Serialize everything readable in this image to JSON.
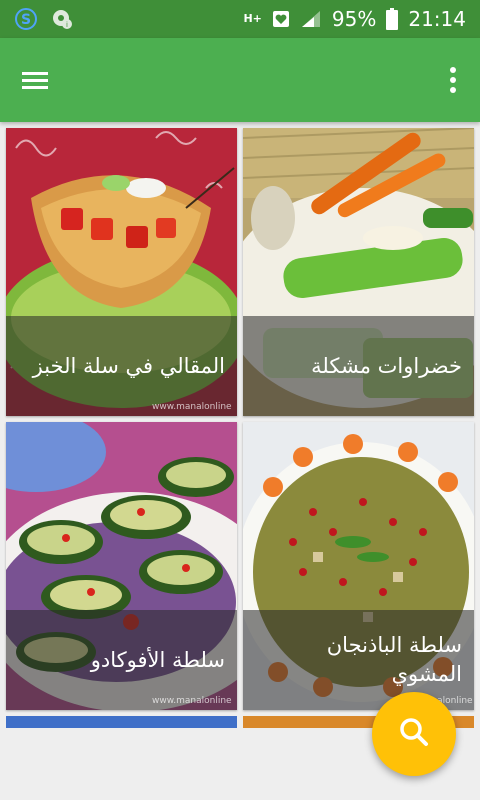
{
  "status_bar": {
    "battery": "95%",
    "time": "21:14",
    "network": "H+",
    "icons": [
      "skype-icon",
      "chrome-notification-icon",
      "network-hplus-icon",
      "heart-notification-icon",
      "signal-icon",
      "battery-icon"
    ]
  },
  "app_bar": {
    "menu_icon": "hamburger-menu-icon",
    "more_icon": "more-vert-icon",
    "color": "#4caf50"
  },
  "recipes": [
    {
      "title": "خضراوات مشكلة"
    },
    {
      "title": "المقالي في سلة الخبز",
      "watermark": "www.manalonline"
    },
    {
      "title": "سلطة الباذنجان المشوي",
      "watermark": "www.manalonline"
    },
    {
      "title": "سلطة الأفوكادو",
      "watermark": "www.manalonline"
    }
  ],
  "fab": {
    "icon": "search-icon",
    "color": "#ffc107"
  }
}
